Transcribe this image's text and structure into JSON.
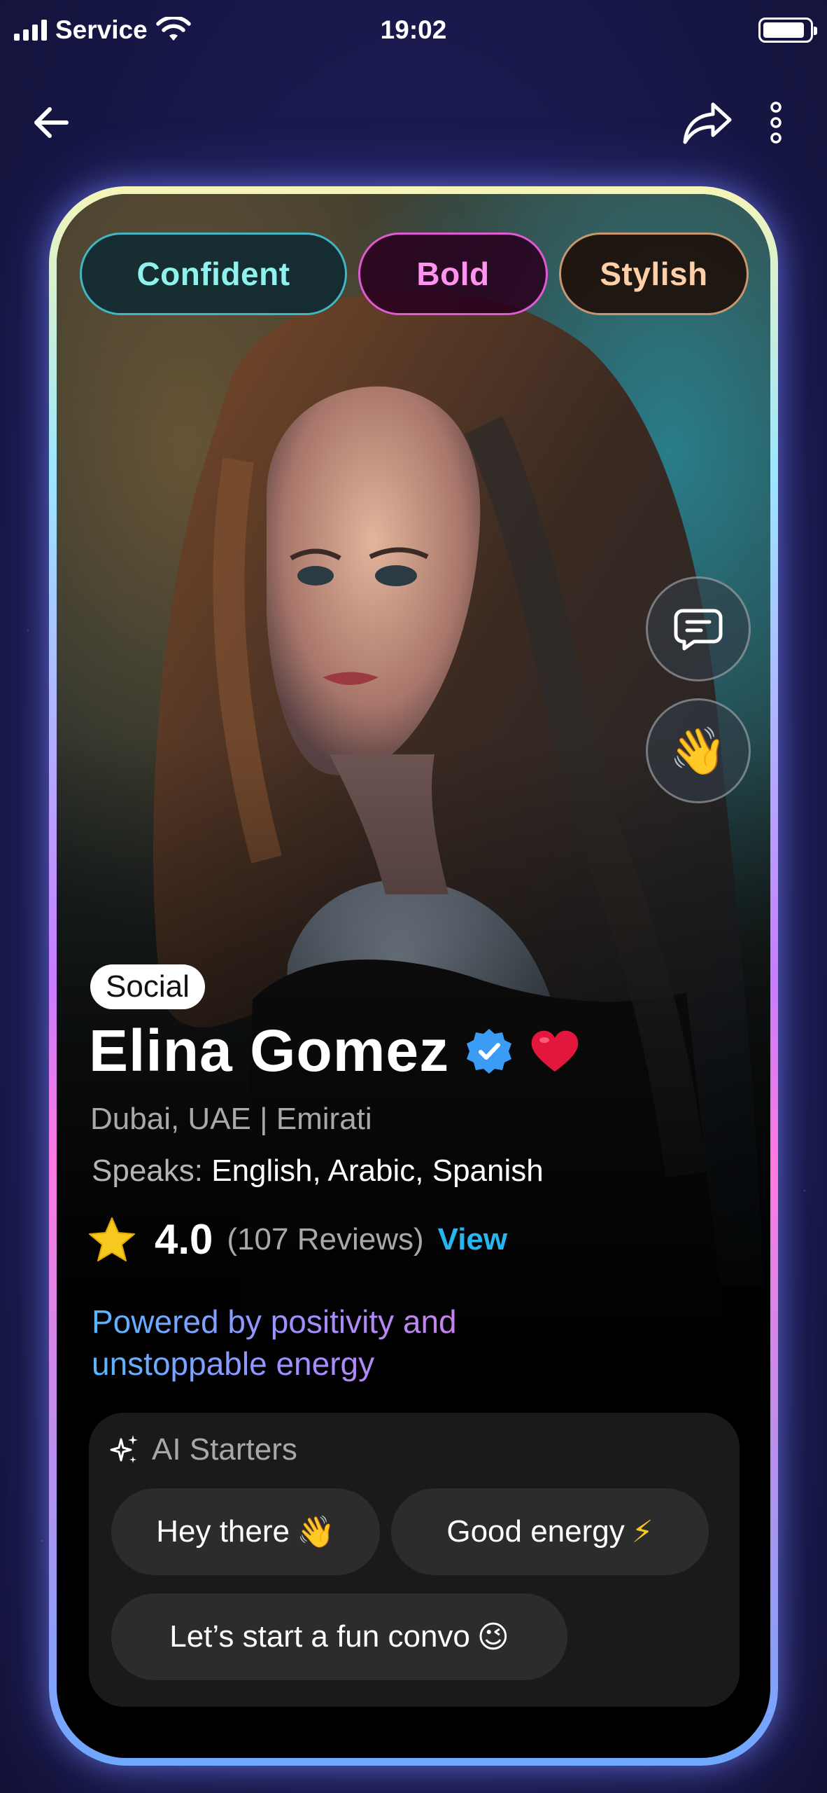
{
  "status_bar": {
    "carrier": "Service",
    "time": "19:02",
    "battery_level": 0.9
  },
  "nav": {
    "back_icon": "arrow-left-icon",
    "share_icon": "share-arrow-icon",
    "more_icon": "vertical-dots-icon"
  },
  "profile": {
    "traits": [
      "Confident",
      "Bold",
      "Stylish"
    ],
    "category": "Social",
    "name": "Elina Gomez",
    "location": "Dubai, UAE | Emirati",
    "speaks_label": "Speaks:",
    "languages": "English, Arabic, Spanish",
    "rating": "4.0",
    "reviews": "(107 Reviews)",
    "view_label": "View",
    "tagline": "Powered by positivity and unstoppable energy"
  },
  "actions": {
    "chat_icon": "chat-bubble-icon",
    "wave_icon": "waving-hand-icon"
  },
  "ai_starters": {
    "title": "AI Starters",
    "chips": [
      {
        "text": "Hey there",
        "emoji": "👋"
      },
      {
        "text": "Good energy",
        "emoji": "⚡"
      },
      {
        "text": "Let’s start a fun convo",
        "emoji": "😉"
      }
    ]
  },
  "colors": {
    "accent_link": "#27b7ef",
    "verified_badge": "#3b9cf5",
    "heart": "#e3173e",
    "star": "#f7c81e"
  }
}
